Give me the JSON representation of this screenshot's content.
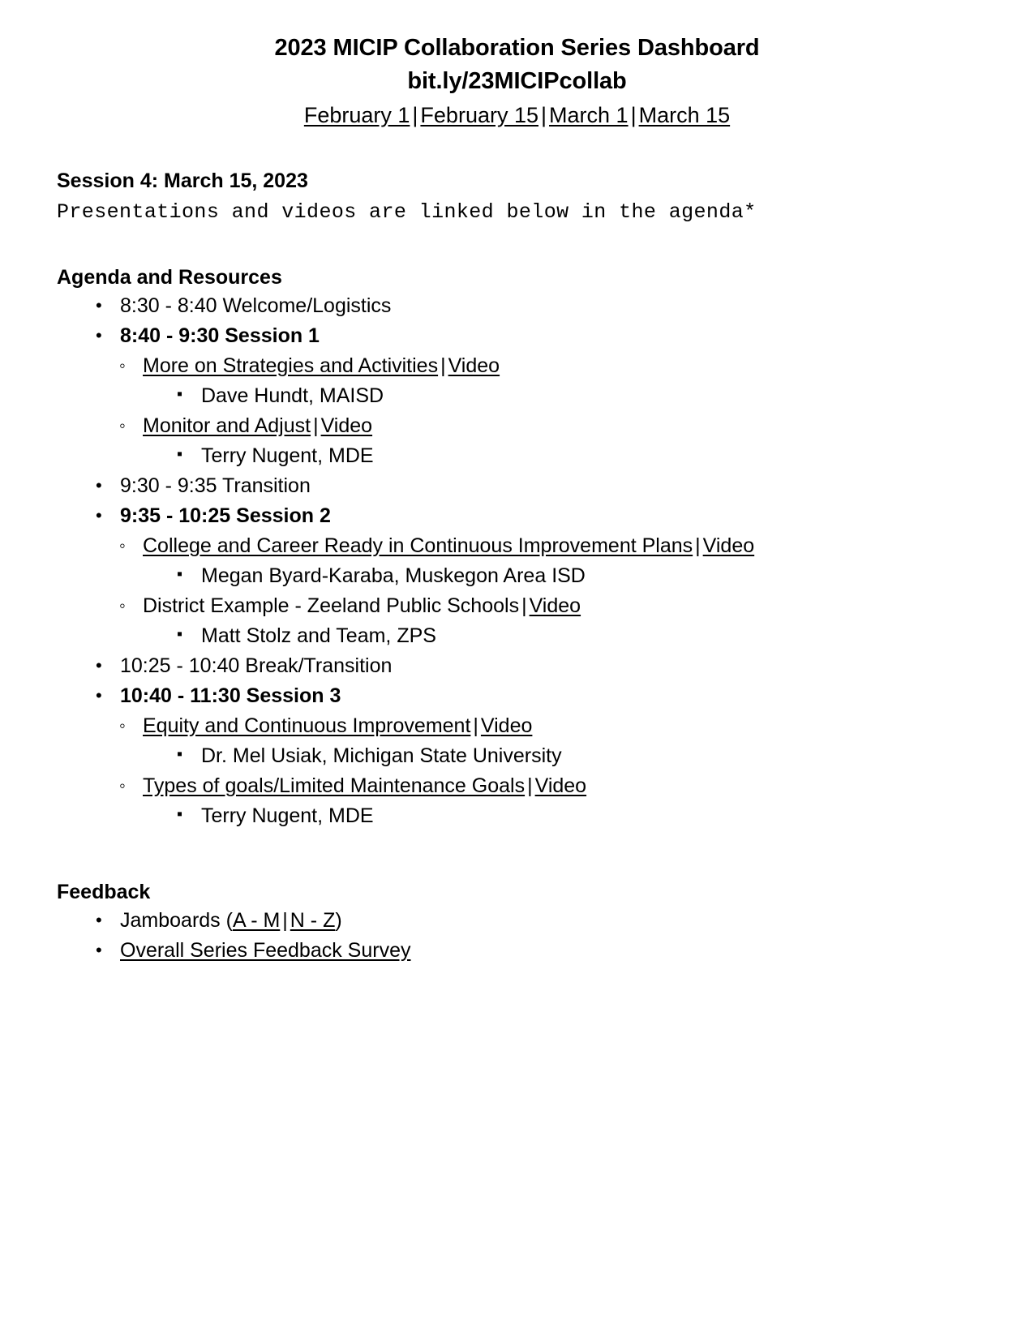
{
  "header": {
    "title": "2023 MICIP Collaboration Series Dashboard",
    "subtitle": "bit.ly/23MICIPcollab",
    "date_links": [
      {
        "label": "February 1"
      },
      {
        "label": "February 15"
      },
      {
        "label": "March 1"
      },
      {
        "label": "March 15"
      }
    ],
    "separator": "|"
  },
  "session": {
    "heading": "Session 4: March 15, 2023",
    "note": "Presentations and videos are linked below in the agenda*"
  },
  "agenda": {
    "heading": "Agenda and Resources",
    "items": [
      {
        "text": "8:30 - 8:40 Welcome/Logistics",
        "bold": false
      },
      {
        "text": "8:40 - 9:30 Session 1",
        "bold": true,
        "children": [
          {
            "link_text": "More on Strategies and Activities",
            "link_is_link": true,
            "video_label": "Video",
            "speakers": [
              "Dave Hundt, MAISD"
            ]
          },
          {
            "link_text": "Monitor and Adjust",
            "link_is_link": true,
            "video_label": "Video",
            "speakers": [
              "Terry Nugent, MDE"
            ]
          }
        ]
      },
      {
        "text": "9:30 - 9:35 Transition",
        "bold": false
      },
      {
        "text": "9:35 - 10:25 Session 2",
        "bold": true,
        "children": [
          {
            "link_text": "College and Career Ready in Continuous Improvement Plans",
            "link_is_link": true,
            "video_label": "Video",
            "speakers": [
              "Megan Byard-Karaba, Muskegon Area ISD"
            ]
          },
          {
            "link_text": "District Example - Zeeland Public Schools",
            "link_is_link": false,
            "video_label": "Video",
            "speakers": [
              "Matt Stolz and Team, ZPS"
            ]
          }
        ]
      },
      {
        "text": "10:25 - 10:40 Break/Transition",
        "bold": false
      },
      {
        "text": "10:40 - 11:30 Session 3",
        "bold": true,
        "children": [
          {
            "link_text": "Equity and Continuous Improvement",
            "link_is_link": true,
            "video_label": "Video",
            "speakers": [
              "Dr. Mel Usiak, Michigan State University"
            ]
          },
          {
            "link_text": "Types of goals/Limited Maintenance Goals",
            "link_is_link": true,
            "video_label": "Video",
            "speakers": [
              "Terry Nugent, MDE"
            ]
          }
        ]
      }
    ]
  },
  "feedback": {
    "heading": "Feedback",
    "jamboards": {
      "prefix": "Jamboards (",
      "link_a": "A - M",
      "separator": "|",
      "link_b": "N - Z",
      "suffix": ")"
    },
    "survey_link": "Overall Series Feedback Survey"
  }
}
